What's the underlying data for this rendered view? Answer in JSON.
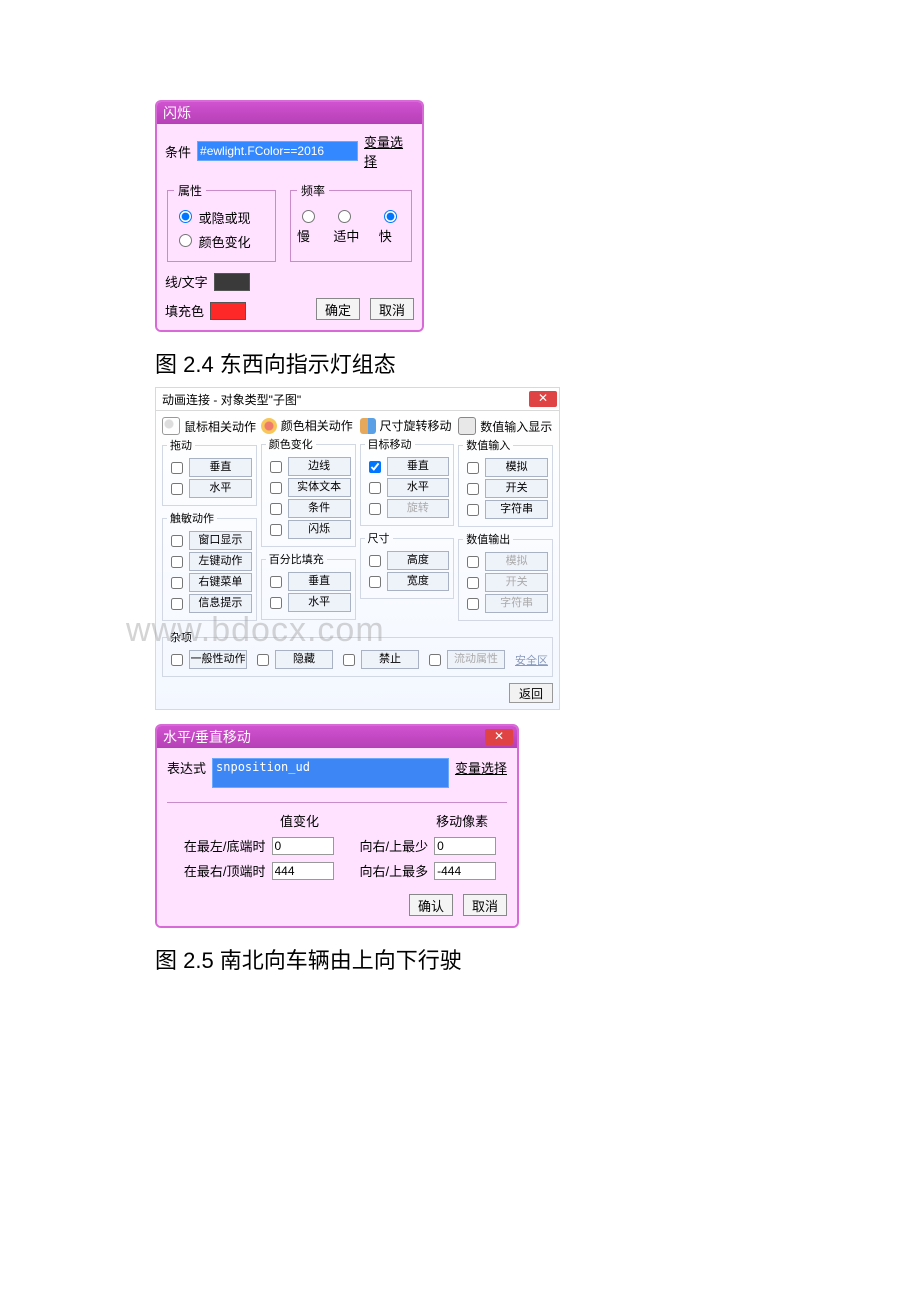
{
  "dialog1": {
    "title": "闪烁",
    "condition_label": "条件",
    "condition_value": "#ewlight.FColor==2016",
    "var_select": "变量选择",
    "attr": {
      "legend": "属性",
      "hide_show": "或隐或现",
      "color_change": "颜色变化"
    },
    "freq": {
      "legend": "频率",
      "slow": "慢",
      "mid": "适中",
      "fast": "快"
    },
    "line_text_label": "线/文字",
    "line_text_color": "#3a3a3a",
    "fill_label": "填充色",
    "fill_color": "#ff2828",
    "ok": "确定",
    "cancel": "取消"
  },
  "caption1": "图 2.4  东西向指示灯组态",
  "dialog2": {
    "title": "动画连接 - 对象类型\"子图\"",
    "col1": {
      "head": "鼠标相关动作",
      "g1": {
        "legend": "拖动",
        "vert": "垂直",
        "horz": "水平"
      },
      "g2": {
        "legend": "触敏动作",
        "win": "窗口显示",
        "lclick": "左键动作",
        "rmenu": "右键菜单",
        "tip": "信息提示"
      }
    },
    "col2": {
      "head": "颜色相关动作",
      "g1": {
        "legend": "颜色变化",
        "edge": "边线",
        "text": "实体文本",
        "cond": "条件",
        "blink": "闪烁"
      },
      "g2": {
        "legend": "百分比填充",
        "vert": "垂直",
        "horz": "水平"
      }
    },
    "col3": {
      "head": "尺寸旋转移动",
      "g1": {
        "legend": "目标移动",
        "vert": "垂直",
        "horz": "水平",
        "rot": "旋转"
      },
      "g2": {
        "legend": "尺寸",
        "h": "高度",
        "w": "宽度"
      }
    },
    "col4": {
      "head": "数值输入显示",
      "g1": {
        "legend": "数值输入",
        "analog": "模拟",
        "sw": "开关",
        "str": "字符串"
      },
      "g2": {
        "legend": "数值输出",
        "analog": "模拟",
        "sw": "开关",
        "str": "字符串"
      }
    },
    "misc": {
      "legend": "杂项",
      "generic": "一般性动作",
      "hide": "隐藏",
      "forbid": "禁止",
      "flowattr": "流动属性",
      "safe": "安全区"
    },
    "back": "返回"
  },
  "watermark": "www.bdocx.com",
  "dialog3": {
    "title": "水平/垂直移动",
    "expr_label": "表达式",
    "expr_value": "snposition_ud",
    "var_select": "变量选择",
    "col1_header": "值变化",
    "col2_header": "移动像素",
    "row1_left": "在最左/底端时",
    "row1_left_val": "0",
    "row1_right": "向右/上最少",
    "row1_right_val": "0",
    "row2_left": "在最右/顶端时",
    "row2_left_val": "444",
    "row2_right": "向右/上最多",
    "row2_right_val": "-444",
    "ok": "确认",
    "cancel": "取消"
  },
  "caption2": "图 2.5 南北向车辆由上向下行驶"
}
